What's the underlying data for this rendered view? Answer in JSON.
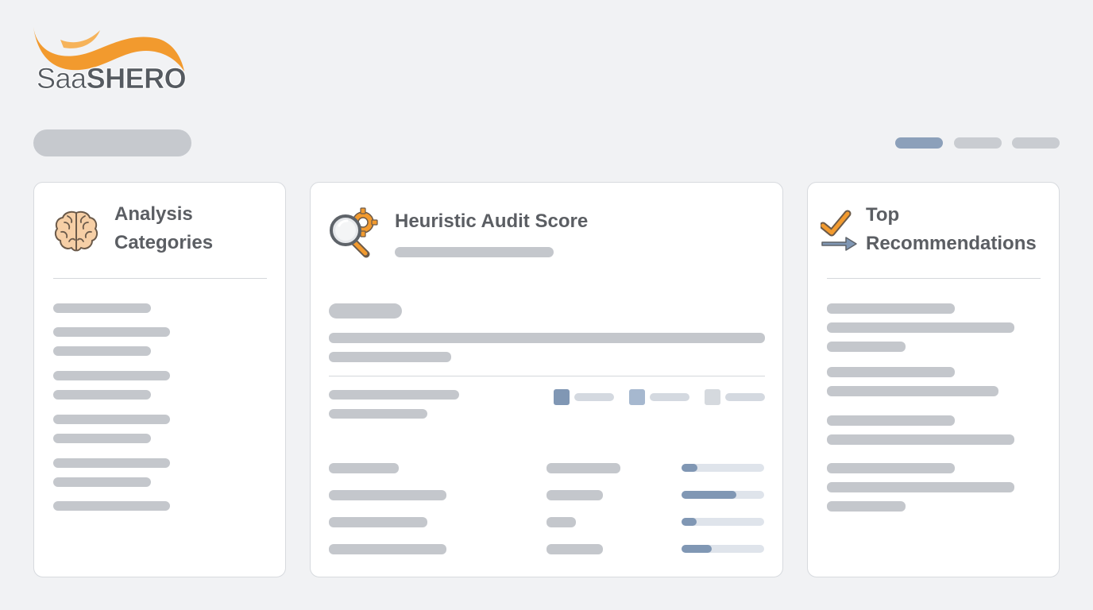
{
  "logo": {
    "text_regular": "Saa",
    "text_bold": "SHERO",
    "accent_color": "#f29a2e"
  },
  "header": {
    "tabs": [
      {
        "icon": "active-dot",
        "active": true
      },
      {
        "icon": "inactive-dot",
        "active": false
      },
      {
        "icon": "inactive-dot",
        "active": false
      }
    ]
  },
  "cards": {
    "analysis": {
      "title_line1": "Analysis",
      "title_line2": "Categories",
      "icon": "brain-icon"
    },
    "audit": {
      "title": "Heuristic Audit Score",
      "icon": "magnifier-gear-icon",
      "score_rows": [
        {
          "progress": 0.19
        },
        {
          "progress": 0.66
        },
        {
          "progress": 0.18
        },
        {
          "progress": 0.37
        }
      ]
    },
    "recommendations": {
      "title_line1": "Top",
      "title_line2": "Recommendations",
      "icon": "check-arrow-icon"
    }
  },
  "colors": {
    "accent_orange": "#f29a2e",
    "skeleton": "#c4c7cc",
    "progress_fill": "#8097b4"
  }
}
